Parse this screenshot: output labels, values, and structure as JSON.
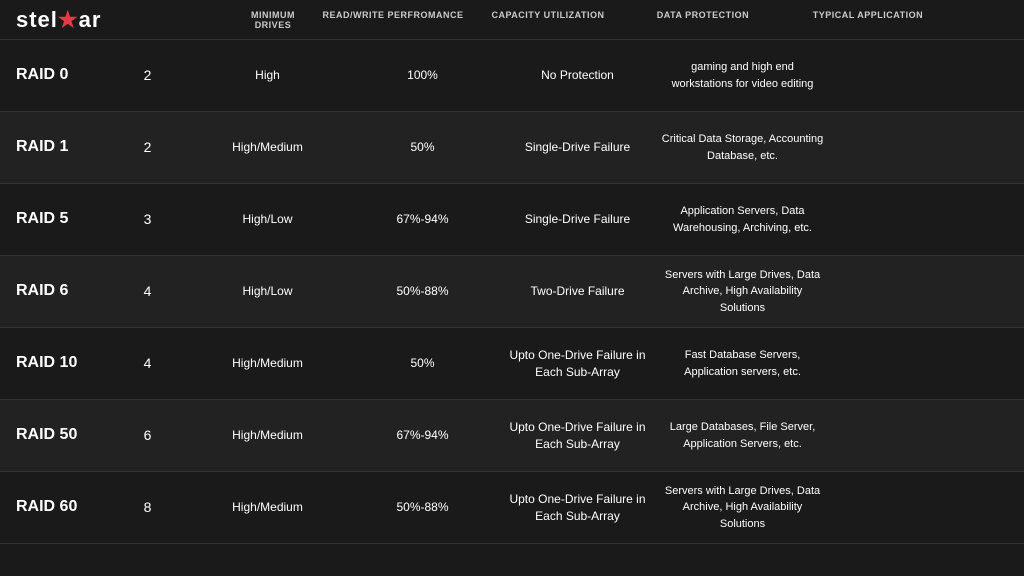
{
  "logo": {
    "text_before": "stel",
    "star": "★",
    "text_after": "ar"
  },
  "columns": {
    "raid": "",
    "drives": "MINIMUM DRIVES",
    "rw": "READ/WRITE PERFROMANCE",
    "cap": "CAPACITY UTILIZATION",
    "prot": "DATA PROTECTION",
    "app": "TYPICAL APPLICATION"
  },
  "rows": [
    {
      "raid": "RAID 0",
      "drives": "2",
      "rw": "High",
      "cap": "100%",
      "prot": "No Protection",
      "app": "gaming and high end workstations for video editing"
    },
    {
      "raid": "RAID 1",
      "drives": "2",
      "rw": "High/Medium",
      "cap": "50%",
      "prot": "Single-Drive Failure",
      "app": "Critical Data Storage, Accounting Database, etc."
    },
    {
      "raid": "RAID 5",
      "drives": "3",
      "rw": "High/Low",
      "cap": "67%-94%",
      "prot": "Single-Drive Failure",
      "app": "Application Servers, Data Warehousing, Archiving, etc."
    },
    {
      "raid": "RAID 6",
      "drives": "4",
      "rw": "High/Low",
      "cap": "50%-88%",
      "prot": "Two-Drive Failure",
      "app": "Servers with Large Drives, Data Archive, High Availability Solutions"
    },
    {
      "raid": "RAID 10",
      "drives": "4",
      "rw": "High/Medium",
      "cap": "50%",
      "prot": "Upto One-Drive Failure in Each Sub-Array",
      "app": "Fast Database Servers, Application servers, etc."
    },
    {
      "raid": "RAID 50",
      "drives": "6",
      "rw": "High/Medium",
      "cap": "67%-94%",
      "prot": "Upto One-Drive Failure in Each Sub-Array",
      "app": "Large Databases, File Server, Application Servers, etc."
    },
    {
      "raid": "RAID 60",
      "drives": "8",
      "rw": "High/Medium",
      "cap": "50%-88%",
      "prot": "Upto One-Drive Failure in Each Sub-Array",
      "app": "Servers with Large Drives, Data Archive, High Availability Solutions"
    }
  ]
}
